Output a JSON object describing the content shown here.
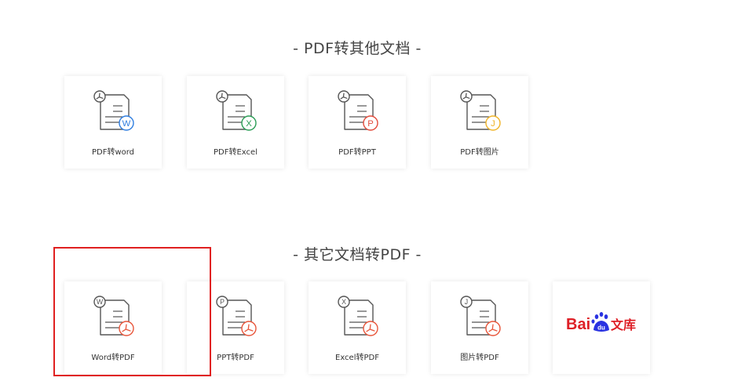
{
  "sections": [
    {
      "title": "- PDF转其他文档 -"
    },
    {
      "title": "- 其它文档转PDF -"
    }
  ],
  "pdf_to_other": [
    {
      "label": "PDF转word",
      "badge_letter": "W",
      "badge_color": "#2f7ee0",
      "icon": "pdf-to-word-icon"
    },
    {
      "label": "PDF转Excel",
      "badge_letter": "X",
      "badge_color": "#2a9d55",
      "icon": "pdf-to-excel-icon"
    },
    {
      "label": "PDF转PPT",
      "badge_letter": "P",
      "badge_color": "#e24b3b",
      "icon": "pdf-to-ppt-icon"
    },
    {
      "label": "PDF转图片",
      "badge_letter": "J",
      "badge_color": "#f0b429",
      "icon": "pdf-to-image-icon"
    }
  ],
  "other_to_pdf": [
    {
      "label": "Word转PDF",
      "source_letter": "W",
      "icon": "word-to-pdf-icon"
    },
    {
      "label": "PPT转PDF",
      "source_letter": "P",
      "icon": "ppt-to-pdf-icon"
    },
    {
      "label": "Excel转PDF",
      "source_letter": "X",
      "icon": "excel-to-pdf-icon"
    },
    {
      "label": "图片转PDF",
      "source_letter": "J",
      "icon": "image-to-pdf-icon"
    }
  ],
  "baidu_wenku": {
    "logo_text_left": "Bai",
    "logo_text_paw": "du",
    "logo_text_right": "文库",
    "icon": "baidu-wenku-logo"
  },
  "colors": {
    "line": "#555555",
    "pdf_red": "#e8553a",
    "baidu_red": "#de1f26",
    "baidu_blue": "#2932e1",
    "highlight": "#e02020"
  }
}
